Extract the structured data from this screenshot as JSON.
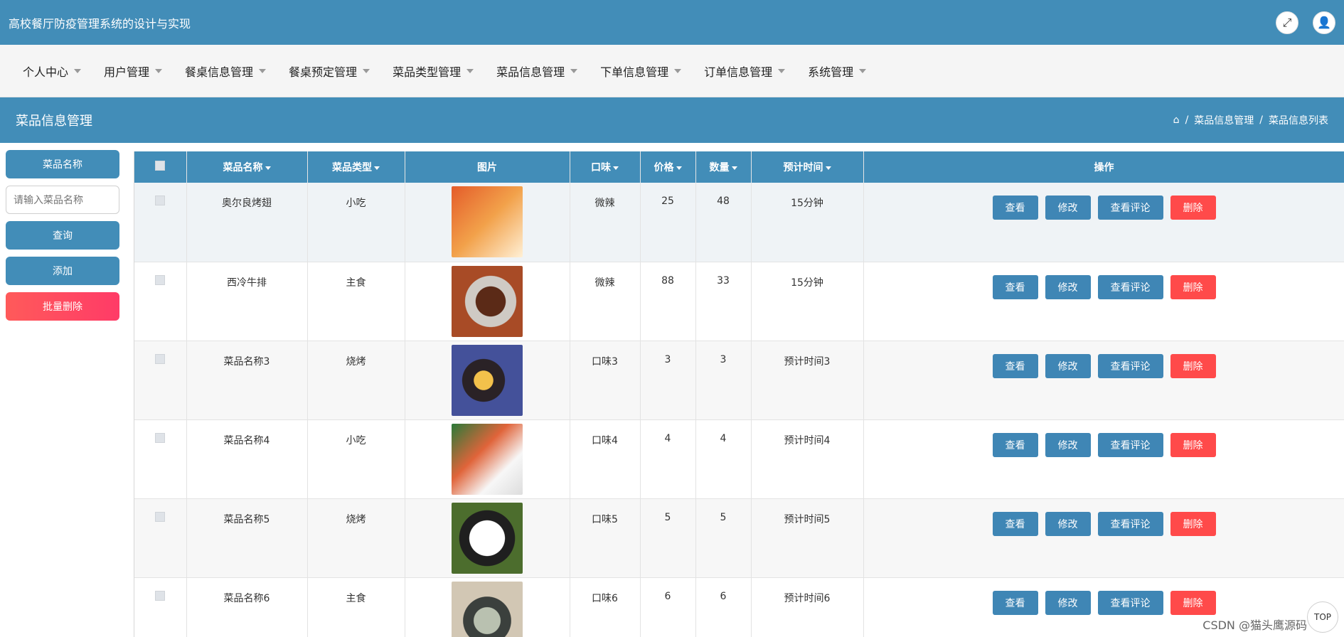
{
  "app": {
    "title": "高校餐厅防疫管理系统的设计与实现",
    "icons": {
      "fullscreen": "⤢",
      "user": "👤"
    }
  },
  "nav": {
    "items": [
      {
        "label": "个人中心"
      },
      {
        "label": "用户管理"
      },
      {
        "label": "餐桌信息管理"
      },
      {
        "label": "餐桌预定管理"
      },
      {
        "label": "菜品类型管理"
      },
      {
        "label": "菜品信息管理"
      },
      {
        "label": "下单信息管理"
      },
      {
        "label": "订单信息管理"
      },
      {
        "label": "系统管理"
      }
    ]
  },
  "page": {
    "title": "菜品信息管理",
    "breadcrumb": [
      "菜品信息管理",
      "菜品信息列表"
    ]
  },
  "filters": {
    "name_label": "菜品名称",
    "name_placeholder": "请输入菜品名称",
    "search_btn": "查询",
    "add_btn": "添加",
    "batch_delete_btn": "批量删除"
  },
  "table": {
    "headers": [
      "菜品名称",
      "菜品类型",
      "图片",
      "口味",
      "价格",
      "数量",
      "预计时间",
      "操作"
    ],
    "rows": [
      {
        "name": "奥尔良烤翅",
        "type": "小吃",
        "taste": "微辣",
        "price": "25",
        "qty": "48",
        "eta": "15分钟",
        "img": "t1"
      },
      {
        "name": "西冷牛排",
        "type": "主食",
        "taste": "微辣",
        "price": "88",
        "qty": "33",
        "eta": "15分钟",
        "img": "t2"
      },
      {
        "name": "菜品名称3",
        "type": "烧烤",
        "taste": "口味3",
        "price": "3",
        "qty": "3",
        "eta": "预计时间3",
        "img": "t3"
      },
      {
        "name": "菜品名称4",
        "type": "小吃",
        "taste": "口味4",
        "price": "4",
        "qty": "4",
        "eta": "预计时间4",
        "img": "t4"
      },
      {
        "name": "菜品名称5",
        "type": "烧烤",
        "taste": "口味5",
        "price": "5",
        "qty": "5",
        "eta": "预计时间5",
        "img": "t5"
      },
      {
        "name": "菜品名称6",
        "type": "主食",
        "taste": "口味6",
        "price": "6",
        "qty": "6",
        "eta": "预计时间6",
        "img": "t6"
      }
    ],
    "row_actions": [
      "查看",
      "修改",
      "查看评论",
      "删除"
    ]
  },
  "footer": {
    "watermark": "CSDN @猫头鹰源码",
    "back_top": "TOP"
  }
}
